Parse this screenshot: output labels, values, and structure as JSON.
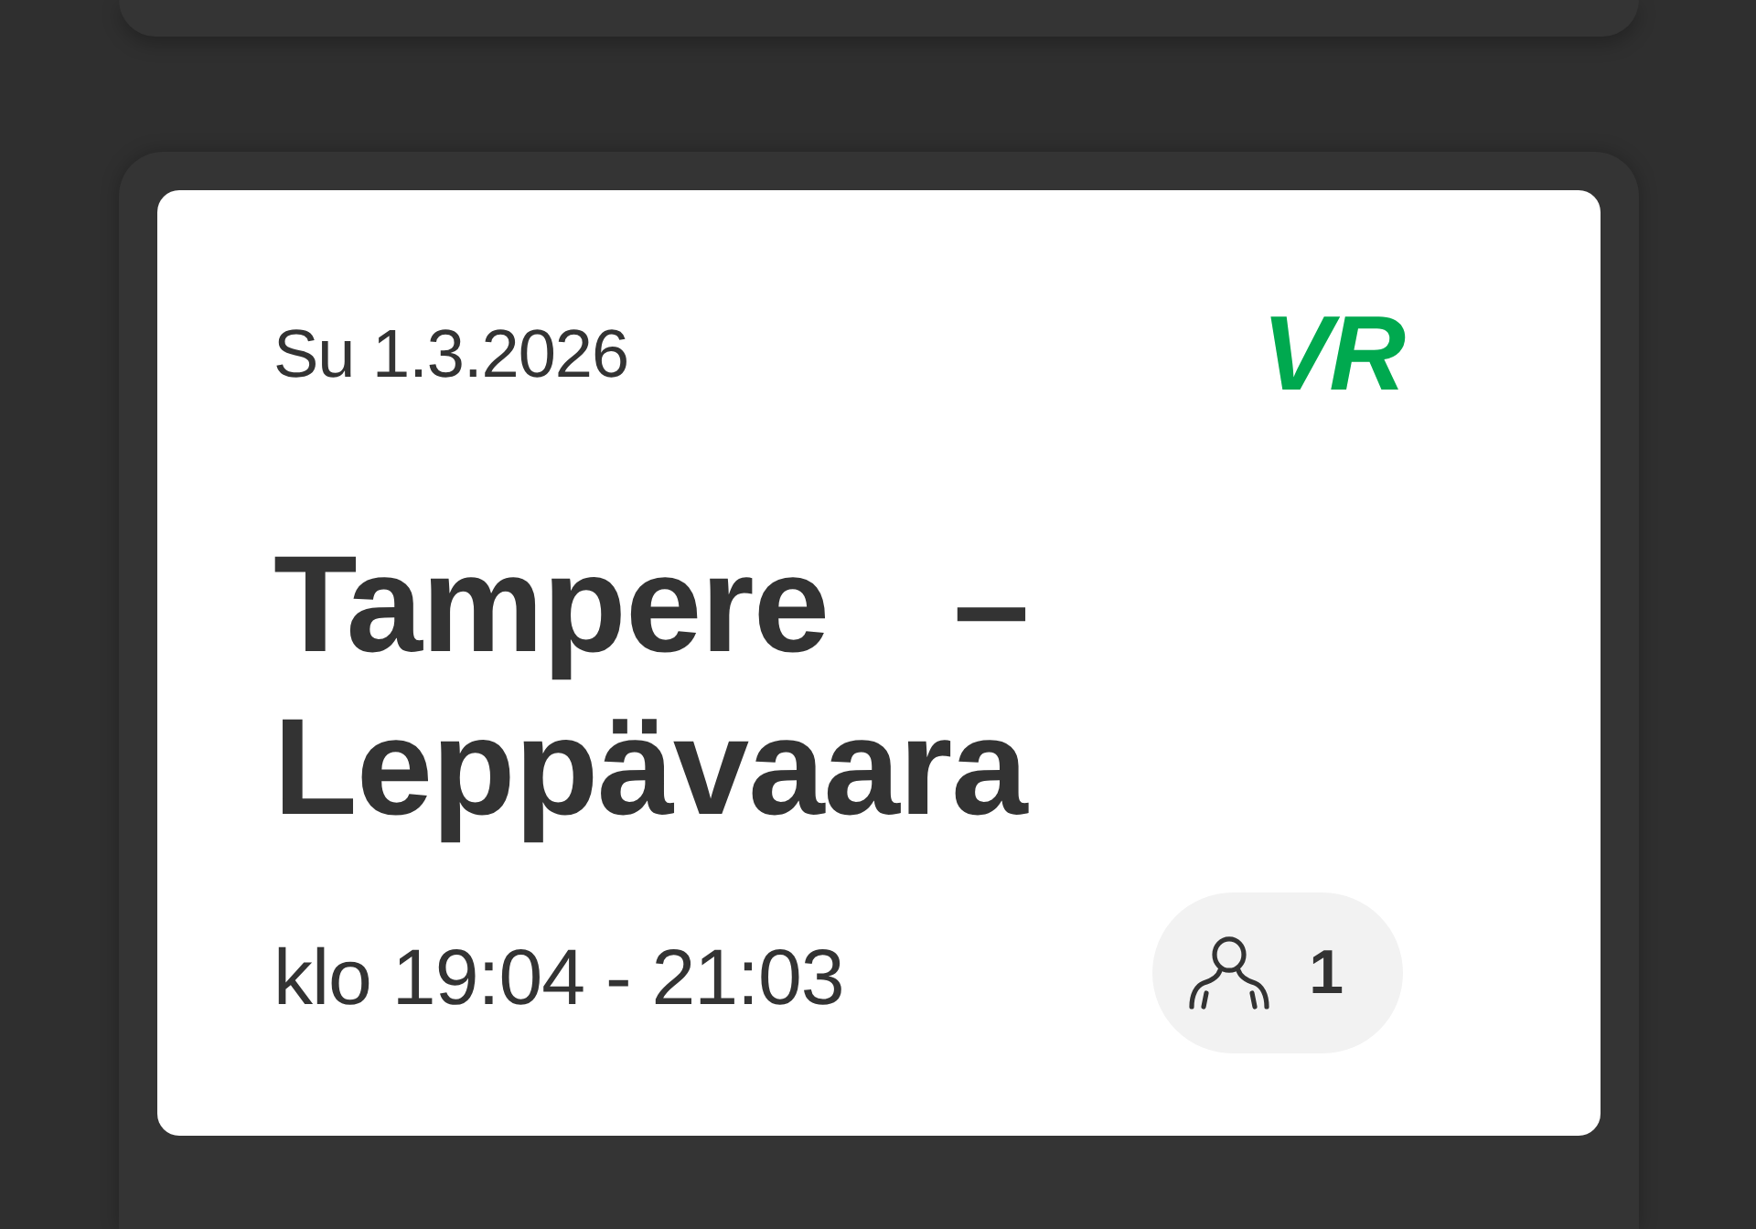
{
  "ticket": {
    "date": "Su 1.3.2026",
    "logo": "VR",
    "route": {
      "from": "Tampere",
      "separator": "–",
      "to": "Leppävaara"
    },
    "time": "klo 19:04 - 21:03",
    "passengers": "1"
  }
}
